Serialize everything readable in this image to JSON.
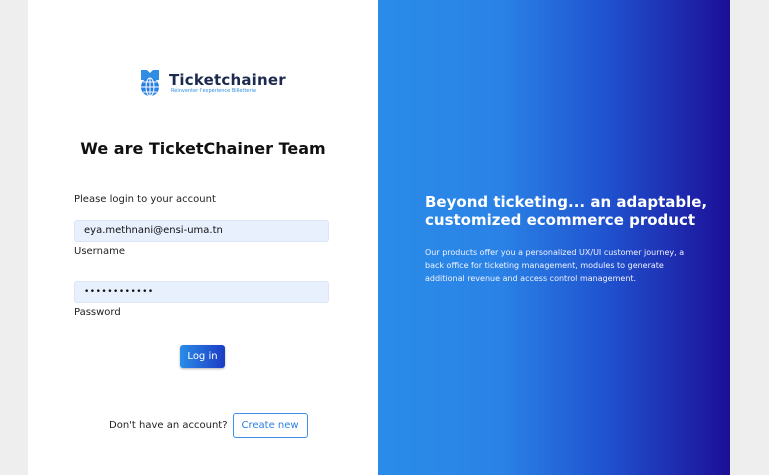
{
  "brand": {
    "name": "Ticketchainer",
    "tagline": "Réinventer l'expérience Billetterie",
    "logo_icon": "ticket-globe-icon",
    "colors": {
      "navy": "#1b2a4e",
      "accent": "#2f8de4",
      "gradient_end": "#1c0f97"
    }
  },
  "login": {
    "title": "We are TicketChainer Team",
    "prompt": "Please login to your account",
    "username_value": "eya.methnani@ensi-uma.tn",
    "username_label": "Username",
    "password_value": "••••••••••••",
    "password_label": "Password",
    "login_button": "Log in",
    "no_account_text": "Don't have an account?",
    "create_button": "Create new"
  },
  "promo": {
    "headline": "Beyond ticketing... an adaptable, customized ecommerce product",
    "description": "Our products offer you a personalized UX/UI customer journey, a back office for ticketing management, modules to generate additional revenue and access control management."
  }
}
